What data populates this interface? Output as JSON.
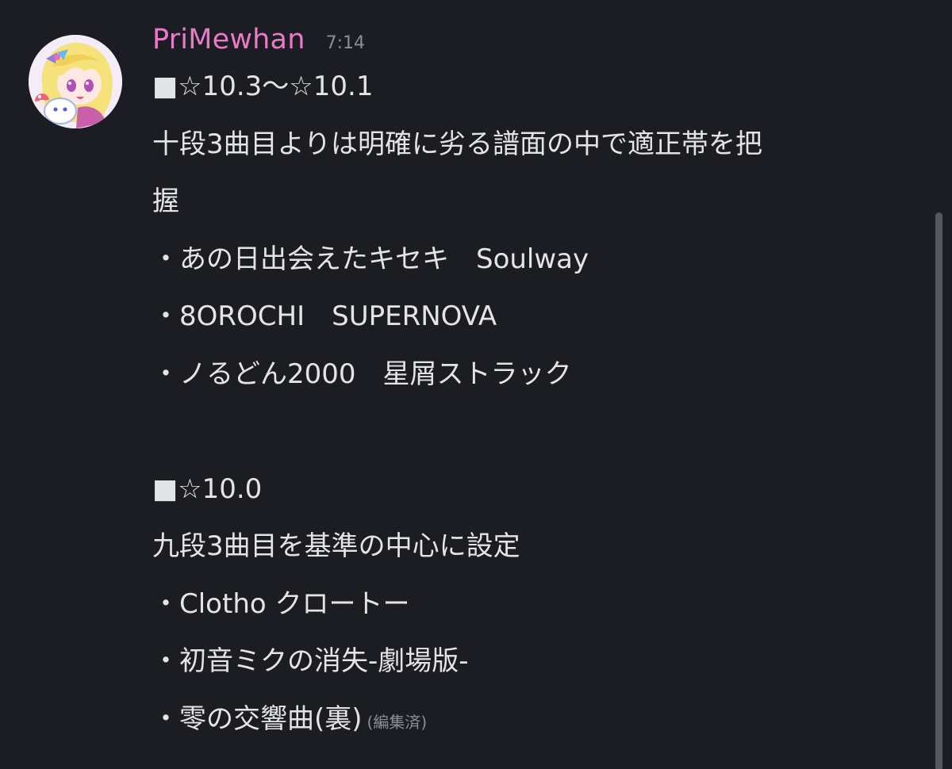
{
  "message": {
    "username": "PriMewhan",
    "timestamp": "7:14",
    "avatar_icon": "anime-girl-avatar-icon",
    "lines": [
      "■☆10.3〜☆10.1",
      "十段3曲目よりは明確に劣る譜面の中で適正帯を把",
      "握",
      "・あの日出会えたキセキ　Soulway",
      "・8OROCHI　SUPERNOVA",
      "・ノるどん2000　星屑ストラック",
      "",
      "■☆10.0",
      "九段3曲目を基準の中心に設定",
      "・Clotho クロートー",
      "・初音ミクの消失-劇場版-",
      "・零の交響曲(裏)"
    ],
    "edited_label": "(編集済)"
  },
  "colors": {
    "background": "#1c1d22",
    "username": "#e87bc7",
    "text": "#e3e4e8",
    "muted": "#8b8e97",
    "scrollbar": "#55575e"
  }
}
